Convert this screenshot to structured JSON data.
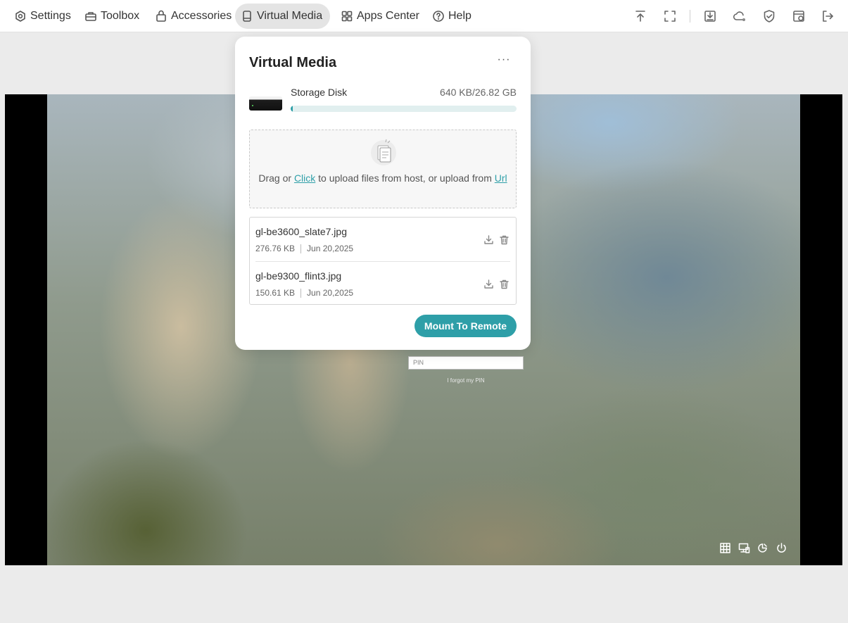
{
  "nav": {
    "items": [
      {
        "label": "Settings",
        "icon": "gear-icon"
      },
      {
        "label": "Toolbox",
        "icon": "toolbox-icon"
      },
      {
        "label": "Accessories",
        "icon": "bag-icon"
      },
      {
        "label": "Virtual Media",
        "icon": "drive-icon",
        "active": true
      },
      {
        "label": "Apps Center",
        "icon": "apps-icon"
      },
      {
        "label": "Help",
        "icon": "help-icon"
      }
    ]
  },
  "toolbar_icons": [
    "upload-icon",
    "fullscreen-icon",
    "download-box-icon",
    "cloud-status-icon",
    "shield-check-icon",
    "calendar-sync-icon",
    "logout-icon"
  ],
  "popup": {
    "title": "Virtual Media",
    "more_label": "···",
    "storage": {
      "name": "Storage Disk",
      "capacity": "640 KB/26.82 GB",
      "used_fraction": 2.3e-05
    },
    "upload": {
      "text_before": "Drag or ",
      "click_label": "Click",
      "text_middle": " to upload files from host, or upload from ",
      "url_label": "Url"
    },
    "files": [
      {
        "name": "gl-be3600_slate7.jpg",
        "size": "276.76 KB",
        "date": "Jun 20,2025"
      },
      {
        "name": "gl-be9300_flint3.jpg",
        "size": "150.61 KB",
        "date": "Jun 20,2025"
      }
    ],
    "mount_label": "Mount To Remote"
  },
  "remote": {
    "pin_placeholder": "PIN",
    "forgot_label": "I forgot my PIN",
    "tray_icons": [
      "keyboard-icon",
      "network-icon",
      "accessibility-icon",
      "power-icon"
    ]
  },
  "colors": {
    "accent": "#2e9fa8",
    "active_nav_bg": "#e4e4e4"
  }
}
